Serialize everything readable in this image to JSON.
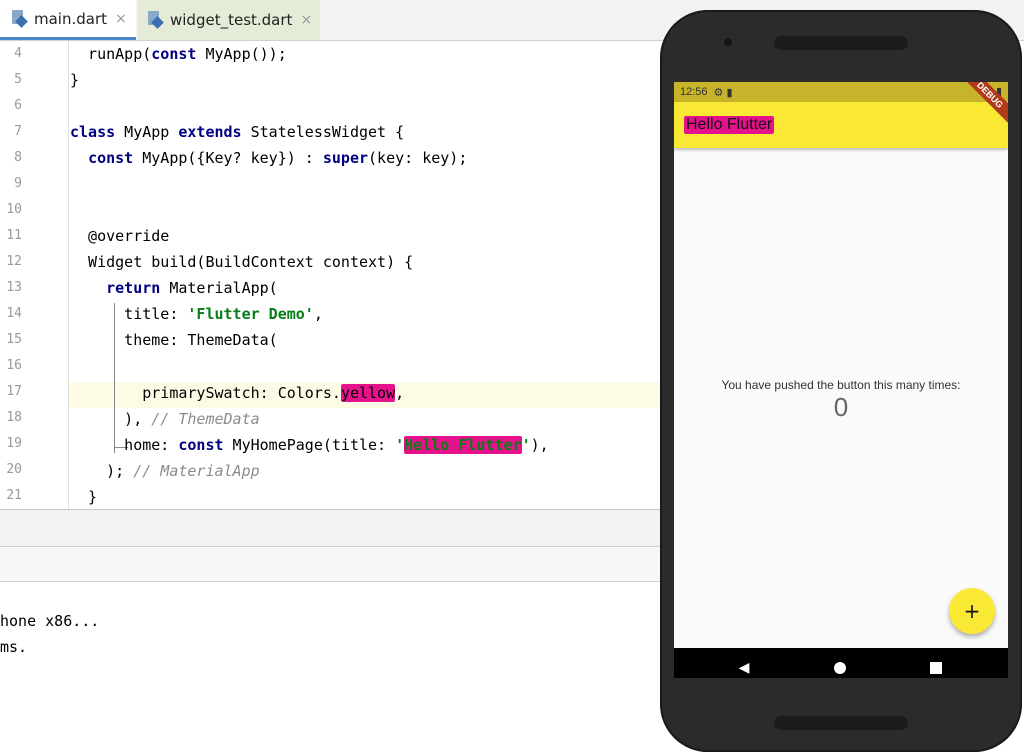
{
  "tabs": [
    {
      "label": "main.dart",
      "close": "×"
    },
    {
      "label": "widget_test.dart",
      "close": "×"
    }
  ],
  "line_numbers": [
    "4",
    "5",
    "6",
    "7",
    "8",
    "9",
    "10",
    "11",
    "12",
    "13",
    "14",
    "15",
    "16",
    "17",
    "18",
    "19",
    "20",
    "21"
  ],
  "code": {
    "l4a": "  runApp(",
    "l4b": "const",
    "l4c": " MyApp());",
    "l5": "}",
    "l7a": "class",
    "l7b": " MyApp ",
    "l7c": "extends",
    "l7d": " StatelessWidget {",
    "l8a": "  ",
    "l8b": "const",
    "l8c": " MyApp({Key? key}) : ",
    "l8d": "super",
    "l8e": "(key: key);",
    "l11": "  @override",
    "l12": "  Widget build(BuildContext context) {",
    "l13a": "    ",
    "l13b": "return",
    "l13c": " MaterialApp(",
    "l14a": "      title: ",
    "l14b": "'Flutter Demo'",
    "l14c": ",",
    "l15": "      theme: ThemeData(",
    "l17a": "        primarySwatch: Colors.",
    "l17b": "yellow",
    "l17c": ",",
    "l18a": "      ), ",
    "l18b": "// ThemeData",
    "l19a": "      home: ",
    "l19b": "const",
    "l19c": " MyHomePage(title: ",
    "l19d": "'",
    "l19e": "Hello Flutter",
    "l19f": "'",
    "l19g": "),",
    "l20a": "    ); ",
    "l20b": "// MaterialApp",
    "l21": "  }"
  },
  "console": {
    "line1": "hone x86...",
    "line2": "ms."
  },
  "phone": {
    "status_time": "12:56",
    "status_icons": "⚙ ▮",
    "status_right": "▼ ▮",
    "debug_banner": "DEBUG",
    "appbar_title": "Hello Flutter",
    "body_text": "You have pushed the button this many times:",
    "counter": "0",
    "fab_label": "+",
    "nav_back": "◀"
  },
  "colors": {
    "appbar": "#f9e834",
    "statusbar": "#c7b42a",
    "highlight_marker": "#e6128c",
    "keyword": "#000080",
    "string": "#067d17"
  }
}
